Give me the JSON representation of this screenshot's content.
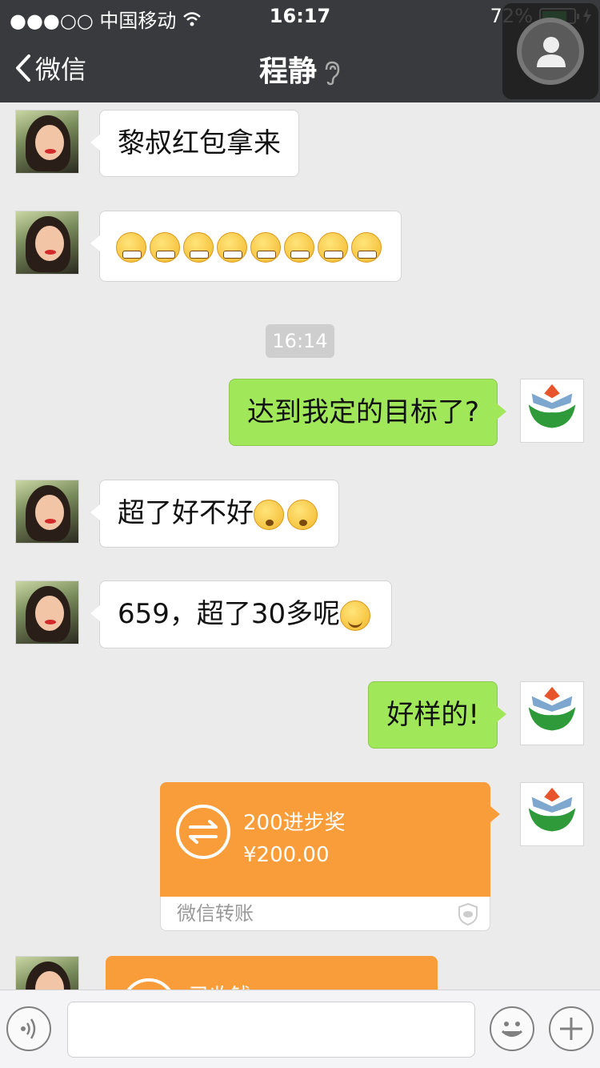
{
  "status_bar": {
    "carrier": "●●●○○ 中国移动",
    "time": "16:17",
    "battery_percent": "72%",
    "battery_level": 0.72
  },
  "nav": {
    "back_label": "微信",
    "title": "程静"
  },
  "messages": [
    {
      "side": "left",
      "sender": "程静",
      "text": "黎叔红包拿来"
    },
    {
      "side": "left",
      "sender": "程静",
      "emojis": [
        "grin-icon",
        "grin-icon",
        "grin-icon",
        "grin-icon",
        "grin-icon",
        "grin-icon",
        "grin-icon",
        "grin-icon"
      ]
    },
    {
      "type": "timestamp",
      "text": "16:14"
    },
    {
      "side": "right",
      "text": "达到我定的目标了?"
    },
    {
      "side": "left",
      "sender": "程静",
      "text": "超了好不好",
      "emojis": [
        "sleepy-icon",
        "sleepy-icon"
      ]
    },
    {
      "side": "left",
      "sender": "程静",
      "text": "659，超了30多呢",
      "emojis": [
        "smile-icon"
      ]
    },
    {
      "side": "right",
      "text": "好样的!"
    },
    {
      "side": "right",
      "type": "transfer",
      "title": "200进步奖",
      "amount": "¥200.00",
      "footer": "微信转账"
    },
    {
      "side": "left",
      "type": "transfer",
      "title": "已收钱"
    }
  ],
  "input_bar": {
    "value": "",
    "placeholder": ""
  },
  "colors": {
    "nav_bg": "#393a3e",
    "chat_bg": "#ebebeb",
    "right_bubble": "#a0e75a",
    "transfer": "#f99d3a"
  }
}
